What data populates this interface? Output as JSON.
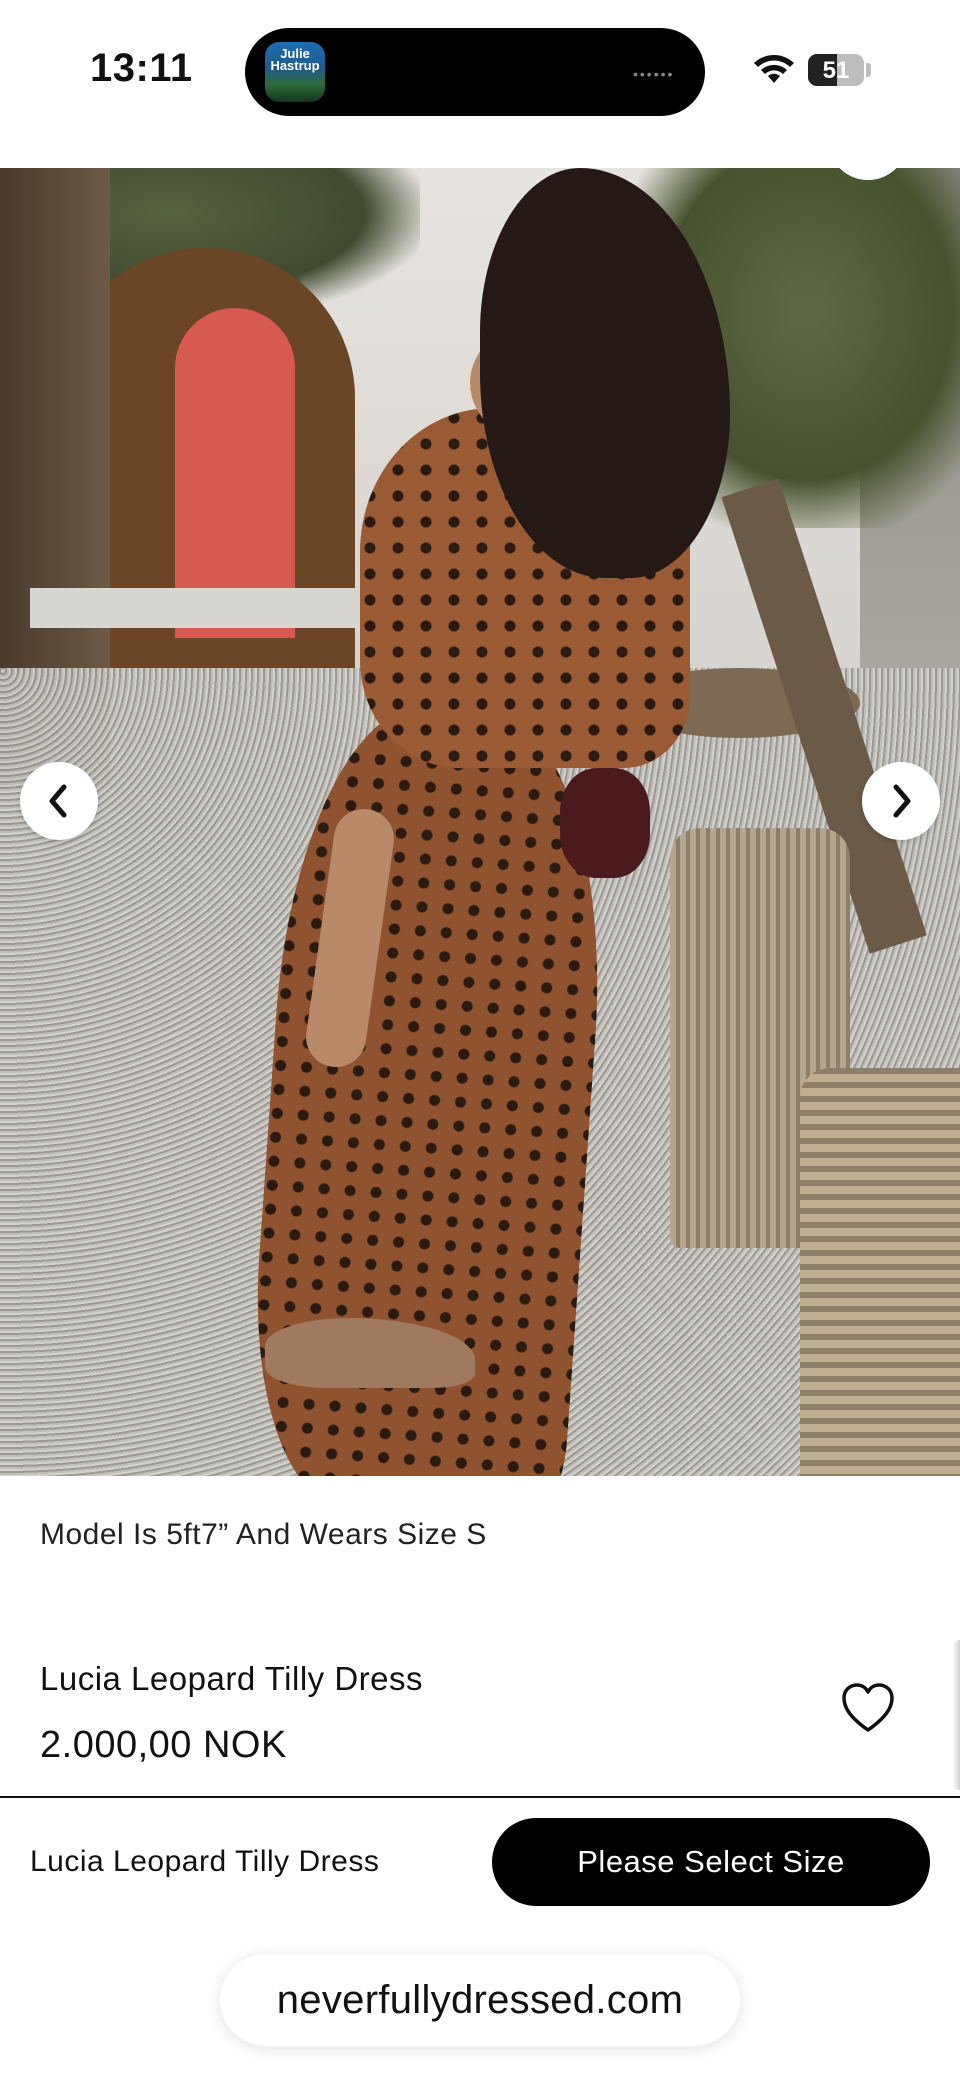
{
  "status_bar": {
    "time": "13:11",
    "battery": "51",
    "battery_level_percent": 51,
    "dynamic_island_app_label": "Julie Hastrup"
  },
  "gallery": {
    "prev_icon": "chevron-left-icon",
    "next_icon": "chevron-right-icon"
  },
  "product": {
    "model_note": "Model Is 5ft7” And Wears Size S",
    "name": "Lucia Leopard Tilly Dress",
    "price": "2.000,00 NOK",
    "wishlist_icon": "heart-icon"
  },
  "sticky_bar": {
    "name": "Lucia Leopard Tilly Dress",
    "cta_label": "Please Select Size"
  },
  "browser": {
    "url": "neverfullydressed.com"
  }
}
